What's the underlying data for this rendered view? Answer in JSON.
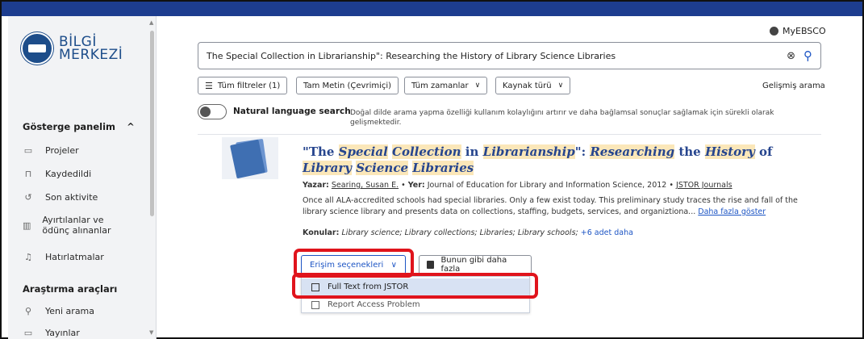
{
  "brand": {
    "line1": "BİLGİ",
    "line2": "MERKEZİ"
  },
  "sidebar": {
    "dashboard": {
      "label": "Gösterge panelim",
      "chevron": "^"
    },
    "items": [
      {
        "label": "Projeler",
        "icon": "folder-icon",
        "glyph": "▭"
      },
      {
        "label": "Kaydedildi",
        "icon": "bookmark-icon",
        "glyph": "⊓"
      },
      {
        "label": "Son aktivite",
        "icon": "history-icon",
        "glyph": "↺"
      },
      {
        "label": "Ayırtılanlar ve ödünç alınanlar",
        "icon": "books-icon",
        "glyph": "▥"
      },
      {
        "label": "Hatırlatmalar",
        "icon": "bell-icon",
        "glyph": "♫"
      }
    ],
    "tools": {
      "label": "Araştırma araçları"
    },
    "tool_items": [
      {
        "label": "Yeni arama",
        "icon": "search-icon",
        "glyph": "⚲"
      },
      {
        "label": "Yayınlar",
        "icon": "publication-icon",
        "glyph": "▭"
      }
    ]
  },
  "header": {
    "myebsco": "MyEBSCO"
  },
  "search": {
    "query": "The Special Collection in Librarianship\": Researching the History of Library Science Libraries"
  },
  "filters": {
    "all_filters": "Tüm filtreler (1)",
    "full_text": "Tam Metin (Çevrimiçi)",
    "all_time": "Tüm zamanlar",
    "source_type": "Kaynak türü",
    "advanced": "Gelişmiş arama"
  },
  "natural_language": {
    "label": "Natural language search",
    "description": "Doğal dilde arama yapma özelliği kullanım kolaylığını artırır ve daha bağlamsal sonuçlar sağlamak için sürekli olarak gelişmektedir."
  },
  "result": {
    "title_parts": [
      {
        "t": "\"The ",
        "hl": false
      },
      {
        "t": "Special",
        "hl": true
      },
      {
        "t": " ",
        "hl": false
      },
      {
        "t": "Collection",
        "hl": true
      },
      {
        "t": " in ",
        "hl": false
      },
      {
        "t": "Librarianship",
        "hl": true
      },
      {
        "t": "\": ",
        "hl": false
      },
      {
        "t": "Researching",
        "hl": true
      },
      {
        "t": " the ",
        "hl": false
      },
      {
        "t": "History",
        "hl": true
      },
      {
        "t": " of ",
        "hl": false
      },
      {
        "t": "Library",
        "hl": true
      },
      {
        "t": " ",
        "hl": false
      },
      {
        "t": "Science",
        "hl": true
      },
      {
        "t": " ",
        "hl": false
      },
      {
        "t": "Libraries",
        "hl": true
      }
    ],
    "author_label": "Yazar:",
    "author": "Searing, Susan E.",
    "venue_label": "Yer:",
    "venue": "Journal of Education for Library and Information Science, 2012",
    "source": "JSTOR Journals",
    "abstract": "Once all ALA-accredited schools had special libraries. Only a few exist today. This preliminary study traces the rise and fall of the library science library and presents data on collections, staffing, budgets, services, and organiztiona...",
    "show_more": "Daha fazla göster",
    "subjects_label": "Konular:",
    "subjects": "Library science; Library collections; Libraries; Library schools;",
    "subjects_more": "+6 adet daha",
    "access_button": "Erişim seçenekleri",
    "similar_button": "Bunun gibi daha fazla",
    "dropdown": [
      "Full Text from JSTOR",
      "Report Access Problem"
    ]
  },
  "colors": {
    "accent": "#1d55c4",
    "title": "#26458e",
    "highlight": "#fbe7b9",
    "annotation": "#e0141c",
    "topbar": "#1d3d8f"
  }
}
